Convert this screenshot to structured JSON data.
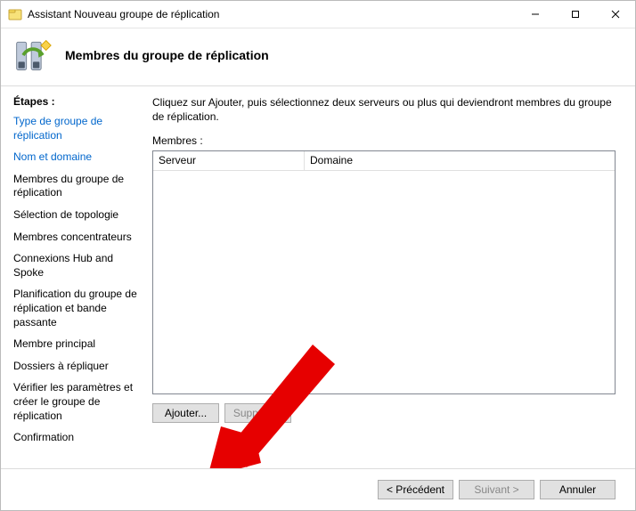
{
  "window": {
    "title": "Assistant Nouveau groupe de réplication"
  },
  "header": {
    "title": "Membres du groupe de réplication"
  },
  "sidebar": {
    "steps_label": "Étapes :",
    "items": [
      {
        "label": "Type de groupe de réplication",
        "link": true
      },
      {
        "label": "Nom et domaine",
        "link": true
      },
      {
        "label": "Membres du groupe de réplication",
        "link": false
      },
      {
        "label": "Sélection de topologie",
        "link": false
      },
      {
        "label": "Membres concentrateurs",
        "link": false
      },
      {
        "label": "Connexions Hub and Spoke",
        "link": false
      },
      {
        "label": "Planification du groupe de réplication et bande passante",
        "link": false
      },
      {
        "label": "Membre principal",
        "link": false
      },
      {
        "label": "Dossiers à répliquer",
        "link": false
      },
      {
        "label": "Vérifier les paramètres et créer le groupe de réplication",
        "link": false
      },
      {
        "label": "Confirmation",
        "link": false
      }
    ]
  },
  "main": {
    "instruction": "Cliquez sur Ajouter, puis sélectionnez deux serveurs ou plus qui deviendront membres du groupe de réplication.",
    "members_label": "Membres :",
    "columns": {
      "server": "Serveur",
      "domain": "Domaine"
    },
    "buttons": {
      "add": "Ajouter...",
      "remove": "Supprimer"
    }
  },
  "footer": {
    "previous": "< Précédent",
    "next": "Suivant >",
    "cancel": "Annuler"
  }
}
